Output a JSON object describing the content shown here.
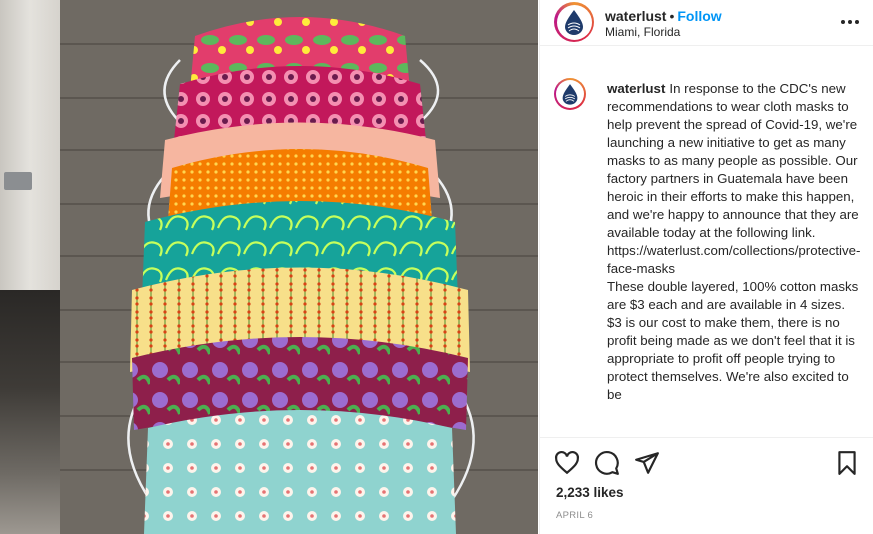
{
  "post": {
    "username": "waterlust",
    "separator": "•",
    "follow_label": "Follow",
    "location": "Miami, Florida",
    "more_icon": "more-horizontal-icon"
  },
  "caption": {
    "username": "waterlust",
    "paragraphs": [
      "In response to the CDC's new recommendations to wear cloth masks to help prevent the spread of Covid-19, we're launching a new initiative to get as many masks to as many people as possible. Our factory partners in Guatemala have been heroic in their efforts to make this happen, and we're happy to announce that they are available today at the following link.",
      "https://waterlust.com/collections/protective-face-masks",
      "These double layered, 100% cotton masks are $3 each and are available in 4 sizes. $3 is our cost to make them, there is no profit being made as we don't feel that it is appropriate to profit off people trying to protect themselves. We're also excited to be"
    ]
  },
  "actions": {
    "icons": [
      "heart-icon",
      "comment-icon",
      "share-icon",
      "bookmark-icon"
    ]
  },
  "likes": "2,233 likes",
  "date": "APRIL 6",
  "colors": {
    "follow": "#0095f6",
    "text": "#262626",
    "muted": "#8e8e8e",
    "wood": "#6f6a63"
  }
}
